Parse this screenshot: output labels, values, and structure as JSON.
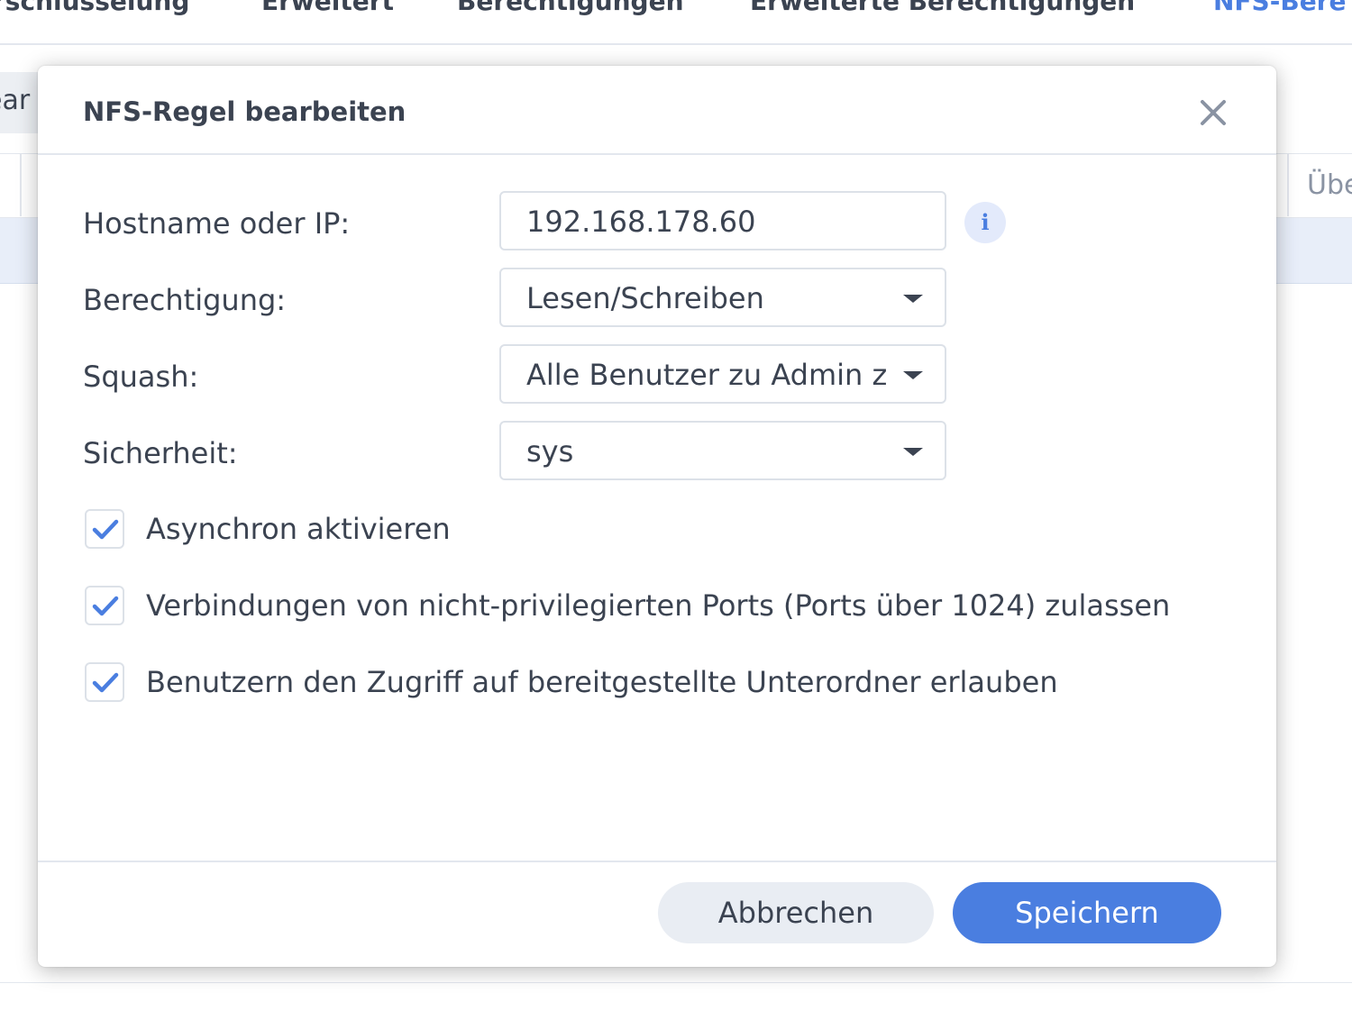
{
  "background": {
    "tabs": [
      {
        "label": "rschlüsselung",
        "active": false
      },
      {
        "label": "Erweitert",
        "active": false
      },
      {
        "label": "Berechtigungen",
        "active": false
      },
      {
        "label": "Erweiterte Berechtigungen",
        "active": false
      },
      {
        "label": "NFS-Bere",
        "active": true
      }
    ],
    "search_fragment": "ear",
    "column_header_fragment": "Übe"
  },
  "dialog": {
    "title": "NFS-Regel bearbeiten",
    "close_icon": "close-icon",
    "fields": {
      "hostname": {
        "label": "Hostname oder IP:",
        "value": "192.168.178.60",
        "info_icon": "i"
      },
      "permission": {
        "label": "Berechtigung:",
        "value": "Lesen/Schreiben"
      },
      "squash": {
        "label": "Squash:",
        "value": "Alle Benutzer zu Admin zuordnen"
      },
      "security": {
        "label": "Sicherheit:",
        "value": "sys"
      }
    },
    "checkboxes": [
      {
        "label": "Asynchron aktivieren",
        "checked": true
      },
      {
        "label": "Verbindungen von nicht-privilegierten Ports (Ports über 1024) zulassen",
        "checked": true
      },
      {
        "label": "Benutzern den Zugriff auf bereitgestellte Unterordner erlauben",
        "checked": true
      }
    ],
    "buttons": {
      "cancel": "Abbrechen",
      "save": "Speichern"
    }
  },
  "colors": {
    "accent": "#4a7ee0",
    "text": "#3b4351",
    "border": "#dce1e8"
  }
}
